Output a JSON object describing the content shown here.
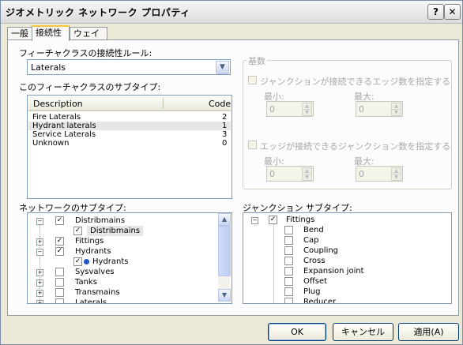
{
  "window": {
    "title": "ジオメトリック ネットワーク プロパティ",
    "help_label": "?",
    "close_label": "✕"
  },
  "tabs": [
    {
      "label": "一般"
    },
    {
      "label": "接続性"
    },
    {
      "label": "ウェイト"
    }
  ],
  "rule": {
    "label": "フィーチャクラスの接続性ルール:",
    "selected": "Laterals"
  },
  "subtypes": {
    "label": "このフィーチャクラスのサブタイプ:",
    "headers": {
      "description": "Description",
      "code": "Code"
    },
    "rows": [
      {
        "description": "Fire Laterals",
        "code": "2"
      },
      {
        "description": "Hydrant laterals",
        "code": "1"
      },
      {
        "description": "Service Laterals",
        "code": "3"
      },
      {
        "description": "Unknown",
        "code": "0"
      }
    ]
  },
  "cardinality": {
    "title": "基数",
    "edge_check_label": "ジャンクションが接続できるエッジ数を指定する",
    "junction_check_label": "エッジが接続できるジャンクション数を指定する",
    "min_label": "最小:",
    "max_label": "最大:",
    "edge_min": "0",
    "edge_max": "0",
    "junction_min": "0",
    "junction_max": "0"
  },
  "network_subtypes": {
    "label": "ネットワークのサブタイプ:",
    "items": [
      {
        "label": "Distribmains",
        "checked": true,
        "expander": "-"
      },
      {
        "label": "Distribmains",
        "checked": true,
        "expander": ""
      },
      {
        "label": "Fittings",
        "checked": true,
        "expander": "+"
      },
      {
        "label": "Hydrants",
        "checked": true,
        "expander": "-"
      },
      {
        "label": "Hydrants",
        "checked": true,
        "expander": ""
      },
      {
        "label": "Sysvalves",
        "checked": false,
        "expander": "+"
      },
      {
        "label": "Tanks",
        "checked": false,
        "expander": "+"
      },
      {
        "label": "Transmains",
        "checked": false,
        "expander": "+"
      },
      {
        "label": "Laterals",
        "checked": false,
        "expander": "+"
      }
    ]
  },
  "junction_subtypes": {
    "label": "ジャンクション サブタイプ:",
    "items": [
      {
        "label": "Fittings",
        "checked": true
      },
      {
        "label": "Bend",
        "checked": false
      },
      {
        "label": "Cap",
        "checked": false
      },
      {
        "label": "Coupling",
        "checked": false
      },
      {
        "label": "Cross",
        "checked": false
      },
      {
        "label": "Expansion joint",
        "checked": false
      },
      {
        "label": "Offset",
        "checked": false
      },
      {
        "label": "Plug",
        "checked": false
      },
      {
        "label": "Reducer",
        "checked": false
      }
    ]
  },
  "buttons": {
    "ok": "OK",
    "cancel": "キャンセル",
    "apply": "適用(A)"
  },
  "colors": {
    "accent_tab": "#ffc83c",
    "selection": "#e6e6e6",
    "border_blue": "#7f9db9"
  }
}
